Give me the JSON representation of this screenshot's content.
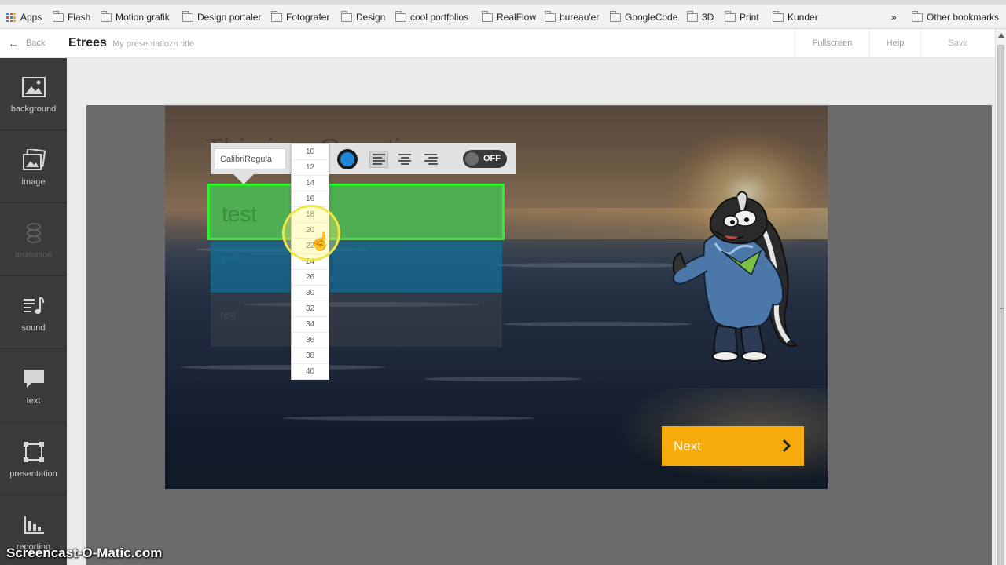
{
  "bookmarks": {
    "apps_label": "Apps",
    "items": [
      "Flash",
      "Motion grafik",
      "Design portaler",
      "Fotografer",
      "Design",
      "cool portfolios",
      "RealFlow",
      "bureau'er",
      "GoogleCode",
      "3D",
      "Print",
      "Kunder"
    ],
    "overflow": "»",
    "other": "Other bookmarks"
  },
  "header": {
    "back_label": "Back",
    "brand": "Etrees",
    "presentation_title": "My presentatiozn title",
    "buttons": {
      "fullscreen": "Fullscreen",
      "help": "Help",
      "save": "Save"
    }
  },
  "sidebar": {
    "items": [
      {
        "label": "background",
        "icon": "image-icon",
        "disabled": false
      },
      {
        "label": "image",
        "icon": "images-icon",
        "disabled": false
      },
      {
        "label": "animation",
        "icon": "spiral-icon",
        "disabled": true
      },
      {
        "label": "sound",
        "icon": "music-note-icon",
        "disabled": false
      },
      {
        "label": "text",
        "icon": "speech-bubble-icon",
        "disabled": false
      },
      {
        "label": "presentation",
        "icon": "frame-icon",
        "disabled": false
      },
      {
        "label": "reporting",
        "icon": "bar-chart-icon",
        "disabled": false
      }
    ]
  },
  "toolbar": {
    "font_value": "CalibriRegula",
    "color": "#1e86d8",
    "toggle_label": "OFF"
  },
  "font_sizes": [
    "10",
    "12",
    "14",
    "16",
    "18",
    "20",
    "22",
    "24",
    "26",
    "30",
    "32",
    "34",
    "36",
    "38",
    "40"
  ],
  "slide": {
    "ghost_title": "This is a Question",
    "text_boxes": [
      "test",
      "test",
      "test"
    ],
    "next_label": "Next",
    "accent_color": "#f7ab0a",
    "selected_border": "#2cf02c"
  },
  "watermark": "Screencast-O-Matic.com"
}
